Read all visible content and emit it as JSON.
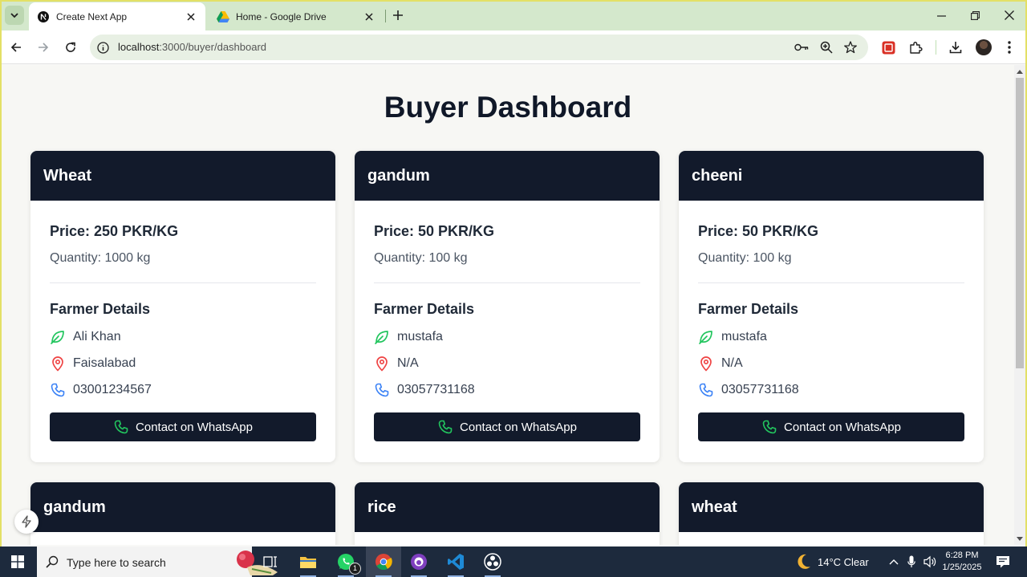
{
  "browser": {
    "tabs": [
      {
        "title": "Create Next App",
        "favicon": "nextjs-icon",
        "active": true
      },
      {
        "title": "Home - Google Drive",
        "favicon": "google-drive-icon",
        "active": false
      }
    ],
    "url_host": "localhost",
    "url_path": ":3000/buyer/dashboard"
  },
  "page": {
    "title": "Buyer Dashboard",
    "listings": [
      {
        "crop": "Wheat",
        "price": "Price: 250 PKR/KG",
        "quantity": "Quantity: 1000 kg",
        "farmer_heading": "Farmer Details",
        "farmer": "Ali Khan",
        "location": "Faisalabad",
        "phone": "03001234567",
        "button": "Contact on WhatsApp"
      },
      {
        "crop": "gandum",
        "price": "Price: 50 PKR/KG",
        "quantity": "Quantity: 100 kg",
        "farmer_heading": "Farmer Details",
        "farmer": "mustafa",
        "location": "N/A",
        "phone": "03057731168",
        "button": "Contact on WhatsApp"
      },
      {
        "crop": "cheeni",
        "price": "Price: 50 PKR/KG",
        "quantity": "Quantity: 100 kg",
        "farmer_heading": "Farmer Details",
        "farmer": "mustafa",
        "location": "N/A",
        "phone": "03057731168",
        "button": "Contact on WhatsApp"
      },
      {
        "crop": "gandum"
      },
      {
        "crop": "rice"
      },
      {
        "crop": "wheat"
      }
    ]
  },
  "colors": {
    "card_header": "#121a2b",
    "leaf_icon": "#22c55e",
    "location_icon": "#ef4444",
    "phone_icon": "#3b82f6"
  },
  "taskbar": {
    "search_placeholder": "Type here to search",
    "whatsapp_badge": "1",
    "weather": "14°C  Clear",
    "time": "6:28 PM",
    "date": "1/25/2025"
  }
}
